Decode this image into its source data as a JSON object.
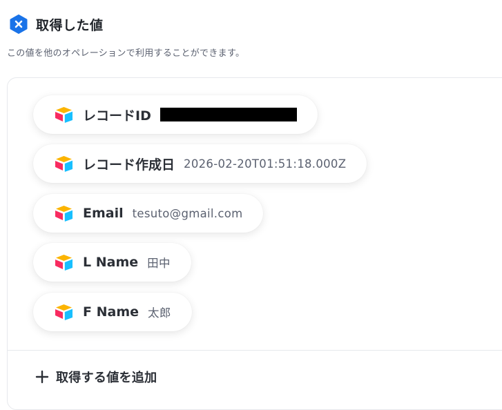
{
  "header": {
    "title": "取得した値",
    "icon": "yoom-hex-icon",
    "icon_color": "#1a73e8"
  },
  "subtitle": "この値を他のオペレーションで利用することができます。",
  "fields": [
    {
      "label": "レコードID",
      "value": "",
      "redacted": true,
      "icon": "airtable-icon"
    },
    {
      "label": "レコード作成日",
      "value": "2026-02-20T01:51:18.000Z",
      "icon": "airtable-icon"
    },
    {
      "label": "Email",
      "value": "tesuto@gmail.com",
      "icon": "airtable-icon"
    },
    {
      "label": "L Name",
      "value": "田中",
      "icon": "airtable-icon"
    },
    {
      "label": "F Name",
      "value": "太郎",
      "icon": "airtable-icon"
    }
  ],
  "add_button": {
    "label": "取得する値を追加",
    "icon": "plus-icon"
  }
}
